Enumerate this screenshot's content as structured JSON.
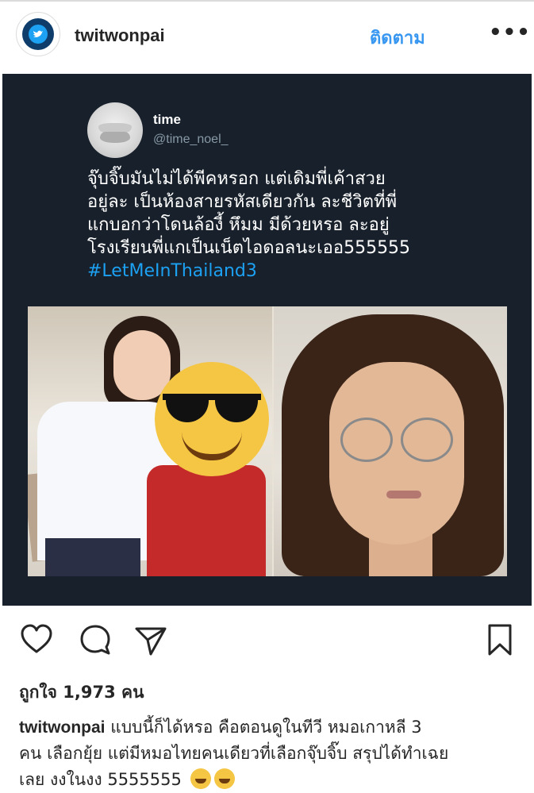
{
  "header": {
    "username": "twitwonpai",
    "follow_label": "ติดตาม",
    "more_label": "•••"
  },
  "tweet": {
    "display_name": "time",
    "handle": "@time_noel_",
    "lines": [
      "จุ๊บจิ๊บมันไม่ได้พีคหรอก แต่เดิมพี่เค้าสวย",
      "อยู่ละ เป็นห้องสายรหัสเดียวกัน ละชีวิตที่พี่",
      "แกบอกว่าโดนล้องี้ หึมม มีด้วยหรอ ละอยู่",
      "โรงเรียนพี่แกเป็นเน็ตไอดอลนะเออ555555"
    ],
    "hashtag": "#LetMeInThailand3"
  },
  "likes": "ถูกใจ 1,973 คน",
  "caption": {
    "username": "twitwonpai",
    "line1": "แบบนี้ก็ได้หรอ คือตอนดูในทีวี หมอเกาหลี 3",
    "line2": "คน เลือกยุ้ย แต่มีหมอไทยคนเดียวที่เลือกจุ๊บจิ๊บ สรุปได้ทำเฉย",
    "line3": "เลย งงในงง 5555555"
  },
  "icons": {
    "like": "heart-icon",
    "comment": "comment-icon",
    "share": "send-icon",
    "save": "bookmark-icon"
  },
  "colors": {
    "link_blue": "#3897f0",
    "twitter_bg": "#17202b",
    "hashtag": "#1da1f2"
  }
}
